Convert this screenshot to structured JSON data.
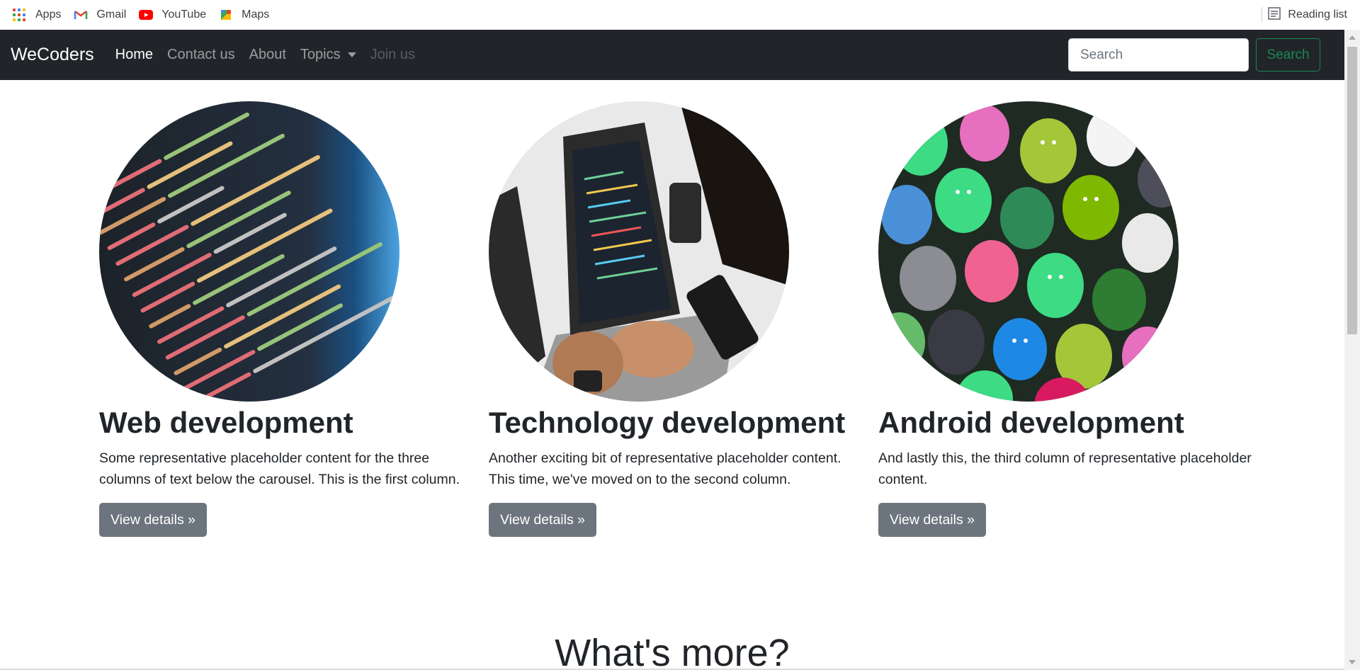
{
  "bookmarks": [
    {
      "label": "Apps",
      "icon": "apps-grid-icon"
    },
    {
      "label": "Gmail",
      "icon": "gmail-icon"
    },
    {
      "label": "YouTube",
      "icon": "youtube-icon"
    },
    {
      "label": "Maps",
      "icon": "maps-icon"
    }
  ],
  "reading_list": {
    "label": "Reading list",
    "icon": "reading-list-icon"
  },
  "navbar": {
    "brand": "WeCoders",
    "links": [
      {
        "label": "Home",
        "state": "active"
      },
      {
        "label": "Contact us",
        "state": "normal"
      },
      {
        "label": "About",
        "state": "normal"
      },
      {
        "label": "Topics",
        "state": "dropdown"
      },
      {
        "label": "Join us",
        "state": "disabled"
      }
    ],
    "search": {
      "placeholder": "Search",
      "value": "",
      "button_label": "Search"
    }
  },
  "columns": [
    {
      "title": "Web development",
      "text": "Some representative placeholder content for the three columns of text below the carousel. This is the first column.",
      "button": "View details »",
      "image": "code-screen-image"
    },
    {
      "title": "Technology development",
      "text": "Another exciting bit of representative placeholder content. This time, we've moved on to the second column.",
      "button": "View details »",
      "image": "laptop-typing-image"
    },
    {
      "title": "Android development",
      "text": "And lastly this, the third column of representative placeholder content.",
      "button": "View details »",
      "image": "android-figures-image"
    }
  ],
  "section_heading": "What's more?",
  "colors": {
    "navbar_bg": "#212529",
    "secondary": "#6c757d",
    "success": "#198754"
  }
}
